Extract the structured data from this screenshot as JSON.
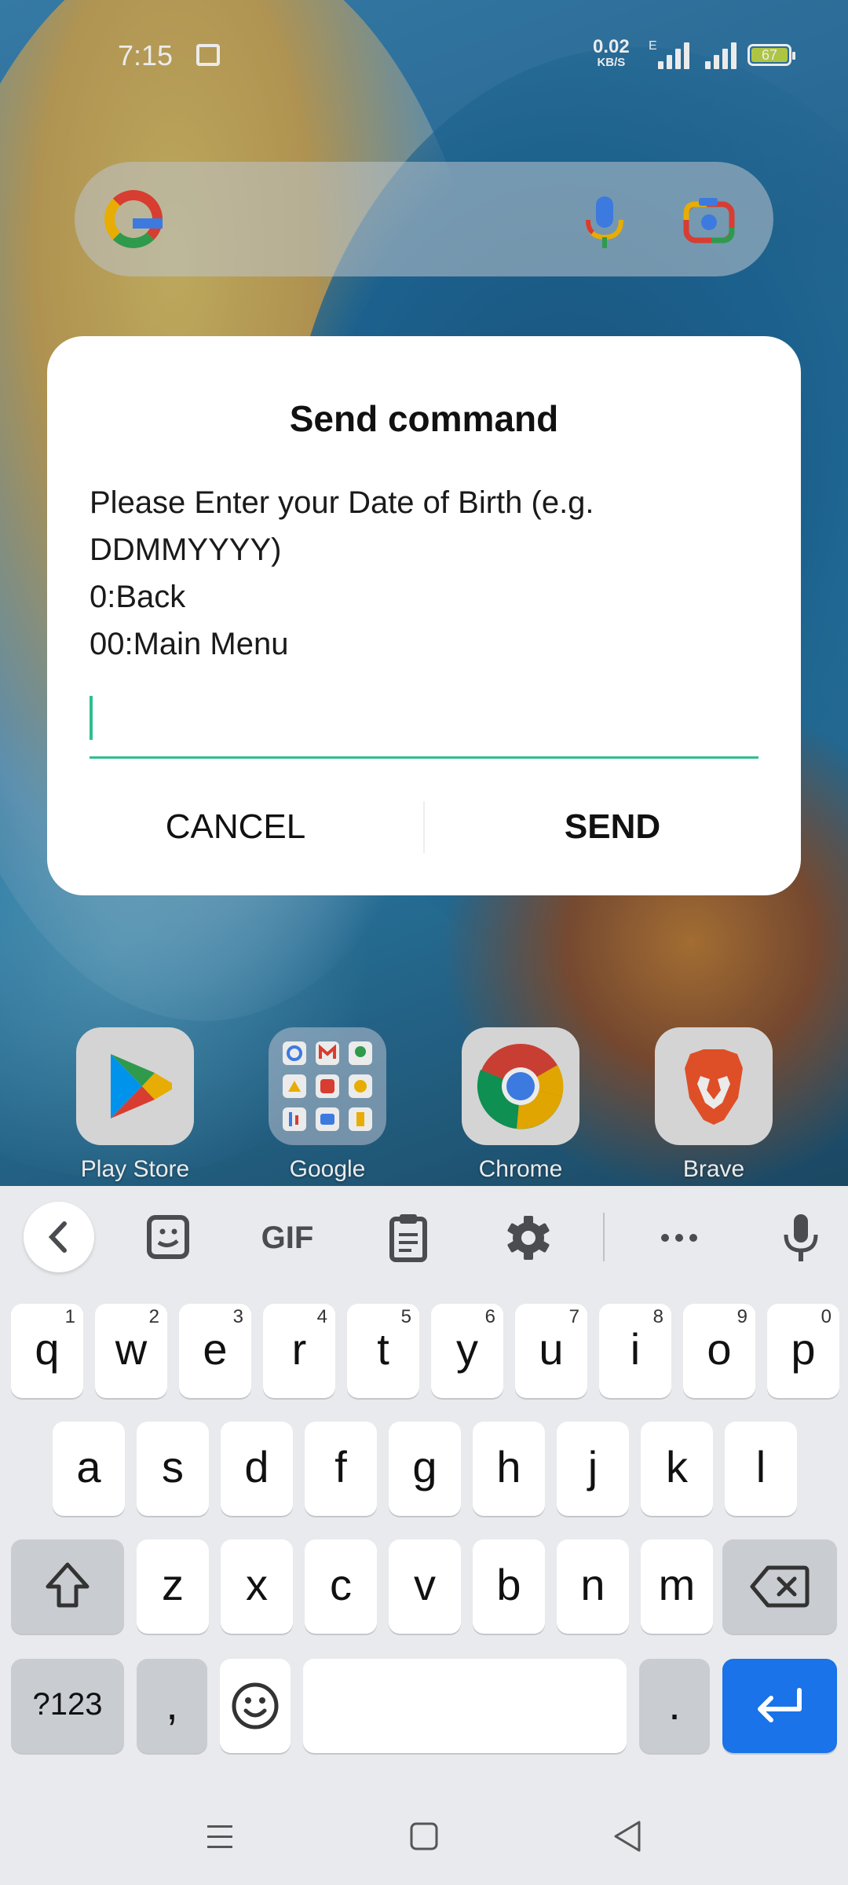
{
  "status_bar": {
    "time": "7:15",
    "net_speed": "0.02",
    "net_speed_unit": "KB/S",
    "network_type": "E",
    "battery": "67"
  },
  "home": {
    "apps": [
      {
        "label": "Play Store",
        "icon": "play-store-icon"
      },
      {
        "label": "Google",
        "icon": "google-folder-icon"
      },
      {
        "label": "Chrome",
        "icon": "chrome-icon"
      },
      {
        "label": "Brave",
        "icon": "brave-icon"
      }
    ]
  },
  "dialog": {
    "title": "Send command",
    "message": "Please Enter your Date of Birth (e.g.\nDDMMYYYY)\n0:Back\n00:Main Menu",
    "input_value": "",
    "cancel_label": "CANCEL",
    "send_label": "SEND",
    "accent_color": "#2fbf8f"
  },
  "keyboard": {
    "toolbar": {
      "gif_label": "GIF"
    },
    "row1": [
      {
        "key": "q",
        "hint": "1"
      },
      {
        "key": "w",
        "hint": "2"
      },
      {
        "key": "e",
        "hint": "3"
      },
      {
        "key": "r",
        "hint": "4"
      },
      {
        "key": "t",
        "hint": "5"
      },
      {
        "key": "y",
        "hint": "6"
      },
      {
        "key": "u",
        "hint": "7"
      },
      {
        "key": "i",
        "hint": "8"
      },
      {
        "key": "o",
        "hint": "9"
      },
      {
        "key": "p",
        "hint": "0"
      }
    ],
    "row2": [
      "a",
      "s",
      "d",
      "f",
      "g",
      "h",
      "j",
      "k",
      "l"
    ],
    "row3": [
      "z",
      "x",
      "c",
      "v",
      "b",
      "n",
      "m"
    ],
    "symbols_label": "?123",
    "comma_label": ",",
    "period_label": ".",
    "enter_color": "#1a73e8"
  }
}
